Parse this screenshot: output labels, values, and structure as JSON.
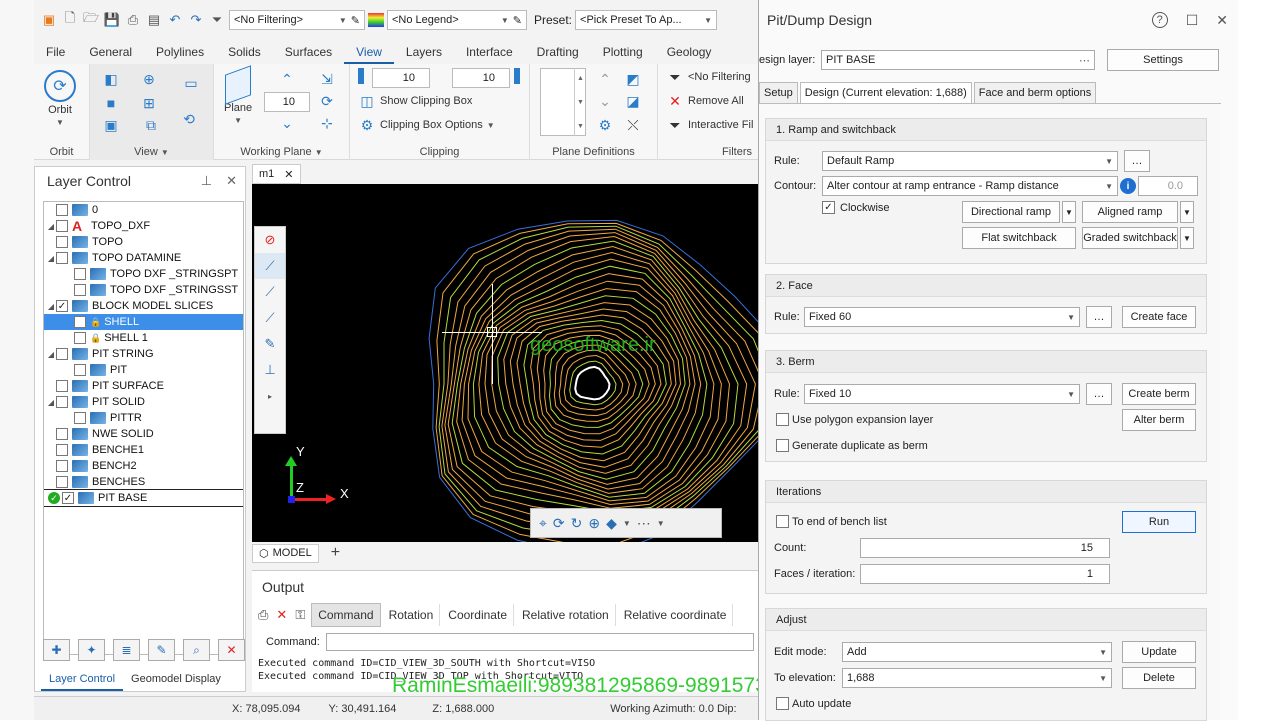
{
  "toolbar": {
    "filter_label": "<No Filtering>",
    "legend_label": "<No Legend>",
    "preset_label": "Preset:",
    "preset_value": "<Pick Preset To Ap..."
  },
  "menu": [
    "File",
    "General",
    "Polylines",
    "Solids",
    "Surfaces",
    "View",
    "Layers",
    "Interface",
    "Drafting",
    "Plotting",
    "Geology"
  ],
  "ribbon": {
    "orbit_label": "Orbit",
    "orbit_group": "Orbit",
    "view_group": "View",
    "plane_label": "Plane",
    "working_plane_value": "10",
    "working_plane_group": "Working Plane",
    "clip_value_1": "10",
    "clip_value_2": "10",
    "show_clipping_box": "Show Clipping Box",
    "clipping_box_options": "Clipping Box Options",
    "clipping_group": "Clipping",
    "plane_definitions_group": "Plane Definitions",
    "no_filtering": "<No Filtering",
    "remove_all": "Remove All",
    "interactive_filter": "Interactive Fil",
    "filters_group": "Filters"
  },
  "layer_control": {
    "title": "Layer Control",
    "items": [
      {
        "label": "0",
        "indent": 0,
        "checked": false,
        "icon": "layer"
      },
      {
        "label": "TOPO_DXF",
        "indent": 0,
        "checked": false,
        "icon": "autocad"
      },
      {
        "label": "TOPO",
        "indent": 0,
        "checked": false,
        "icon": "layer"
      },
      {
        "label": "TOPO DATAMINE",
        "indent": 0,
        "checked": false,
        "icon": "layer"
      },
      {
        "label": "TOPO DXF _STRINGSPT",
        "indent": 1,
        "checked": false,
        "icon": "layer"
      },
      {
        "label": "TOPO DXF _STRINGSST",
        "indent": 1,
        "checked": false,
        "icon": "layer"
      },
      {
        "label": "BLOCK MODEL SLICES",
        "indent": 0,
        "checked": true,
        "icon": "layer"
      },
      {
        "label": "SHELL",
        "indent": 1,
        "checked": false,
        "icon": "lock"
      },
      {
        "label": "SHELL 1",
        "indent": 1,
        "checked": false,
        "icon": "lock"
      },
      {
        "label": "PIT STRING",
        "indent": 0,
        "checked": false,
        "icon": "layer"
      },
      {
        "label": "PIT",
        "indent": 1,
        "checked": false,
        "icon": "layer"
      },
      {
        "label": "PIT SURFACE",
        "indent": 0,
        "checked": false,
        "icon": "layer"
      },
      {
        "label": "PIT SOLID",
        "indent": 0,
        "checked": false,
        "icon": "layer"
      },
      {
        "label": "PITTR",
        "indent": 1,
        "checked": false,
        "icon": "layer"
      },
      {
        "label": "NWE SOLID",
        "indent": 0,
        "checked": false,
        "icon": "layer"
      },
      {
        "label": "BENCHE1",
        "indent": 0,
        "checked": false,
        "icon": "layer"
      },
      {
        "label": "BENCH2",
        "indent": 0,
        "checked": false,
        "icon": "layer"
      },
      {
        "label": "BENCHES",
        "indent": 0,
        "checked": false,
        "icon": "layer"
      },
      {
        "label": "PIT BASE",
        "indent": 0,
        "checked": true,
        "icon": "layer"
      }
    ],
    "tabs": [
      "Layer Control",
      "Geomodel Display"
    ]
  },
  "viewport": {
    "tab_name": "m1",
    "axis_y": "Y",
    "axis_z": "Z",
    "axis_x": "X",
    "model_tab": "MODEL"
  },
  "output": {
    "title": "Output",
    "tabs": [
      "Command",
      "Rotation",
      "Coordinate",
      "Relative rotation",
      "Relative coordinate"
    ],
    "command_label": "Command:",
    "log": [
      "Executed command ID=CID_VIEW_3D_SOUTH with Shortcut=VISO",
      "Executed command ID=CID_VIEW_3D_TOP with Shortcut=VITO"
    ]
  },
  "status": {
    "x": "X: 78,095.094",
    "y": "Y: 30,491.164",
    "z": "Z: 1,688.000",
    "azimuth": "Working Azimuth: 0.0 Dip:"
  },
  "watermarks": {
    "site": "geosoftware.ir",
    "contact": "RaminEsmaeili:989381295869-989157330367"
  },
  "dialog": {
    "title": "Pit/Dump Design",
    "design_layer_label": "esign layer:",
    "design_layer_value": "PIT BASE",
    "settings_button": "Settings",
    "tabs": [
      "Setup",
      "Design (Current elevation: 1,688)",
      "Face and berm options"
    ],
    "ramp": {
      "header": "1. Ramp and switchback",
      "rule_label": "Rule:",
      "rule_value": "Default Ramp",
      "contour_label": "Contour:",
      "contour_value": "Alter contour at ramp entrance - Ramp distance",
      "contour_number": "0.0",
      "clockwise_label": "Clockwise",
      "directional_ramp": "Directional ramp",
      "aligned_ramp": "Aligned ramp",
      "flat_switchback": "Flat switchback",
      "graded_switchback": "Graded switchback"
    },
    "face": {
      "header": "2. Face",
      "rule_label": "Rule:",
      "rule_value": "Fixed 60",
      "create_face": "Create face"
    },
    "berm": {
      "header": "3. Berm",
      "rule_label": "Rule:",
      "rule_value": "Fixed 10",
      "create_berm": "Create berm",
      "polygon_expansion": "Use polygon expansion layer",
      "alter_berm": "Alter berm",
      "generate_duplicate": "Generate duplicate as berm"
    },
    "iterations": {
      "header": "Iterations",
      "to_end_label": "To end of bench list",
      "run_button": "Run",
      "count_label": "Count:",
      "count_value": "15",
      "faces_label": "Faces / iteration:",
      "faces_value": "1"
    },
    "adjust": {
      "header": "Adjust",
      "edit_mode_label": "Edit mode:",
      "edit_mode_value": "Add",
      "update_button": "Update",
      "to_elevation_label": "To elevation:",
      "to_elevation_value": "1,688",
      "delete_button": "Delete",
      "auto_update_label": "Auto update"
    }
  },
  "colors": {
    "accent": "#1a5ea8",
    "selection": "#3c8ee8",
    "contour_outer": "#3a6fd8",
    "contour_inner": "#f0a840",
    "bench_green": "#b8d838",
    "watermark": "#22bb22"
  }
}
